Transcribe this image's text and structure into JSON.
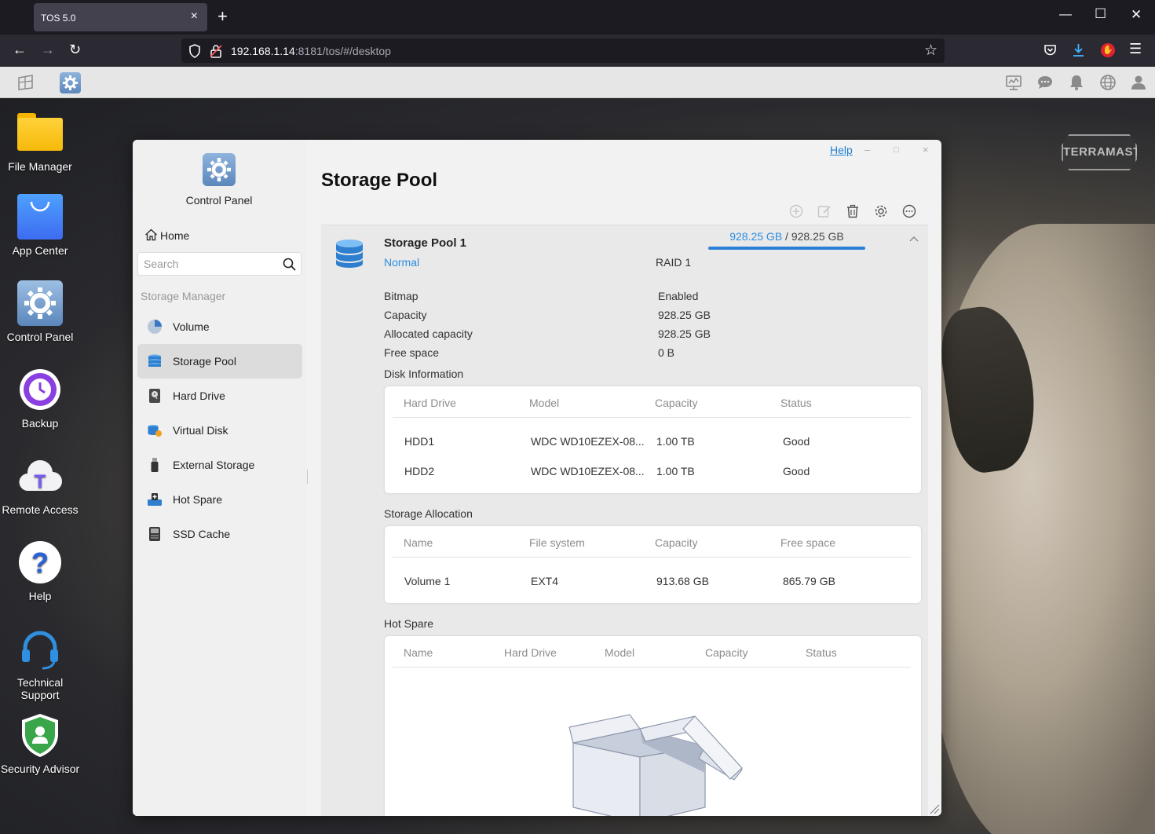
{
  "browser": {
    "tab_title": "TOS 5.0",
    "tab_close": "×",
    "new_tab": "+",
    "url_host": "192.168.1.14",
    "url_rest": ":8181/tos/#/desktop"
  },
  "desktop": {
    "brand": "TERRAMASTER",
    "icons": [
      {
        "label": "File Manager"
      },
      {
        "label": "App Center"
      },
      {
        "label": "Control Panel"
      },
      {
        "label": "Backup"
      },
      {
        "label": "Remote Access"
      },
      {
        "label": "Help"
      },
      {
        "label": "Technical Support"
      },
      {
        "label": "Security Advisor"
      }
    ]
  },
  "window": {
    "help": "Help",
    "app_title": "Control Panel",
    "home": "Home",
    "search_placeholder": "Search",
    "section": "Storage Manager",
    "menu": [
      {
        "label": "Volume"
      },
      {
        "label": "Storage Pool"
      },
      {
        "label": "Hard Drive"
      },
      {
        "label": "Virtual Disk"
      },
      {
        "label": "External Storage"
      },
      {
        "label": "Hot Spare"
      },
      {
        "label": "SSD Cache"
      }
    ],
    "page_title": "Storage Pool"
  },
  "pool": {
    "name": "Storage Pool 1",
    "status": "Normal",
    "raid": "RAID 1",
    "used": "928.25 GB",
    "separator": " / ",
    "total": "928.25 GB",
    "usage_fraction": 1.0,
    "props": [
      {
        "label": "Bitmap",
        "value": "Enabled"
      },
      {
        "label": "Capacity",
        "value": "928.25 GB"
      },
      {
        "label": "Allocated capacity",
        "value": "928.25 GB"
      },
      {
        "label": "Free space",
        "value": "0 B"
      }
    ],
    "disk_info": {
      "title": "Disk Information",
      "headers": [
        "Hard Drive",
        "Model",
        "Capacity",
        "Status"
      ],
      "rows": [
        [
          "HDD1",
          "WDC WD10EZEX-08...",
          "1.00 TB",
          "Good"
        ],
        [
          "HDD2",
          "WDC WD10EZEX-08...",
          "1.00 TB",
          "Good"
        ]
      ]
    },
    "allocation": {
      "title": "Storage Allocation",
      "headers": [
        "Name",
        "File system",
        "Capacity",
        "Free space"
      ],
      "rows": [
        [
          "Volume 1",
          "EXT4",
          "913.68 GB",
          "865.79 GB"
        ]
      ]
    },
    "hot_spare": {
      "title": "Hot Spare",
      "headers": [
        "Name",
        "Hard Drive",
        "Model",
        "Capacity",
        "Status"
      ]
    }
  },
  "colors": {
    "accent": "#2b8de0",
    "active_item": "#dcdcdc"
  }
}
